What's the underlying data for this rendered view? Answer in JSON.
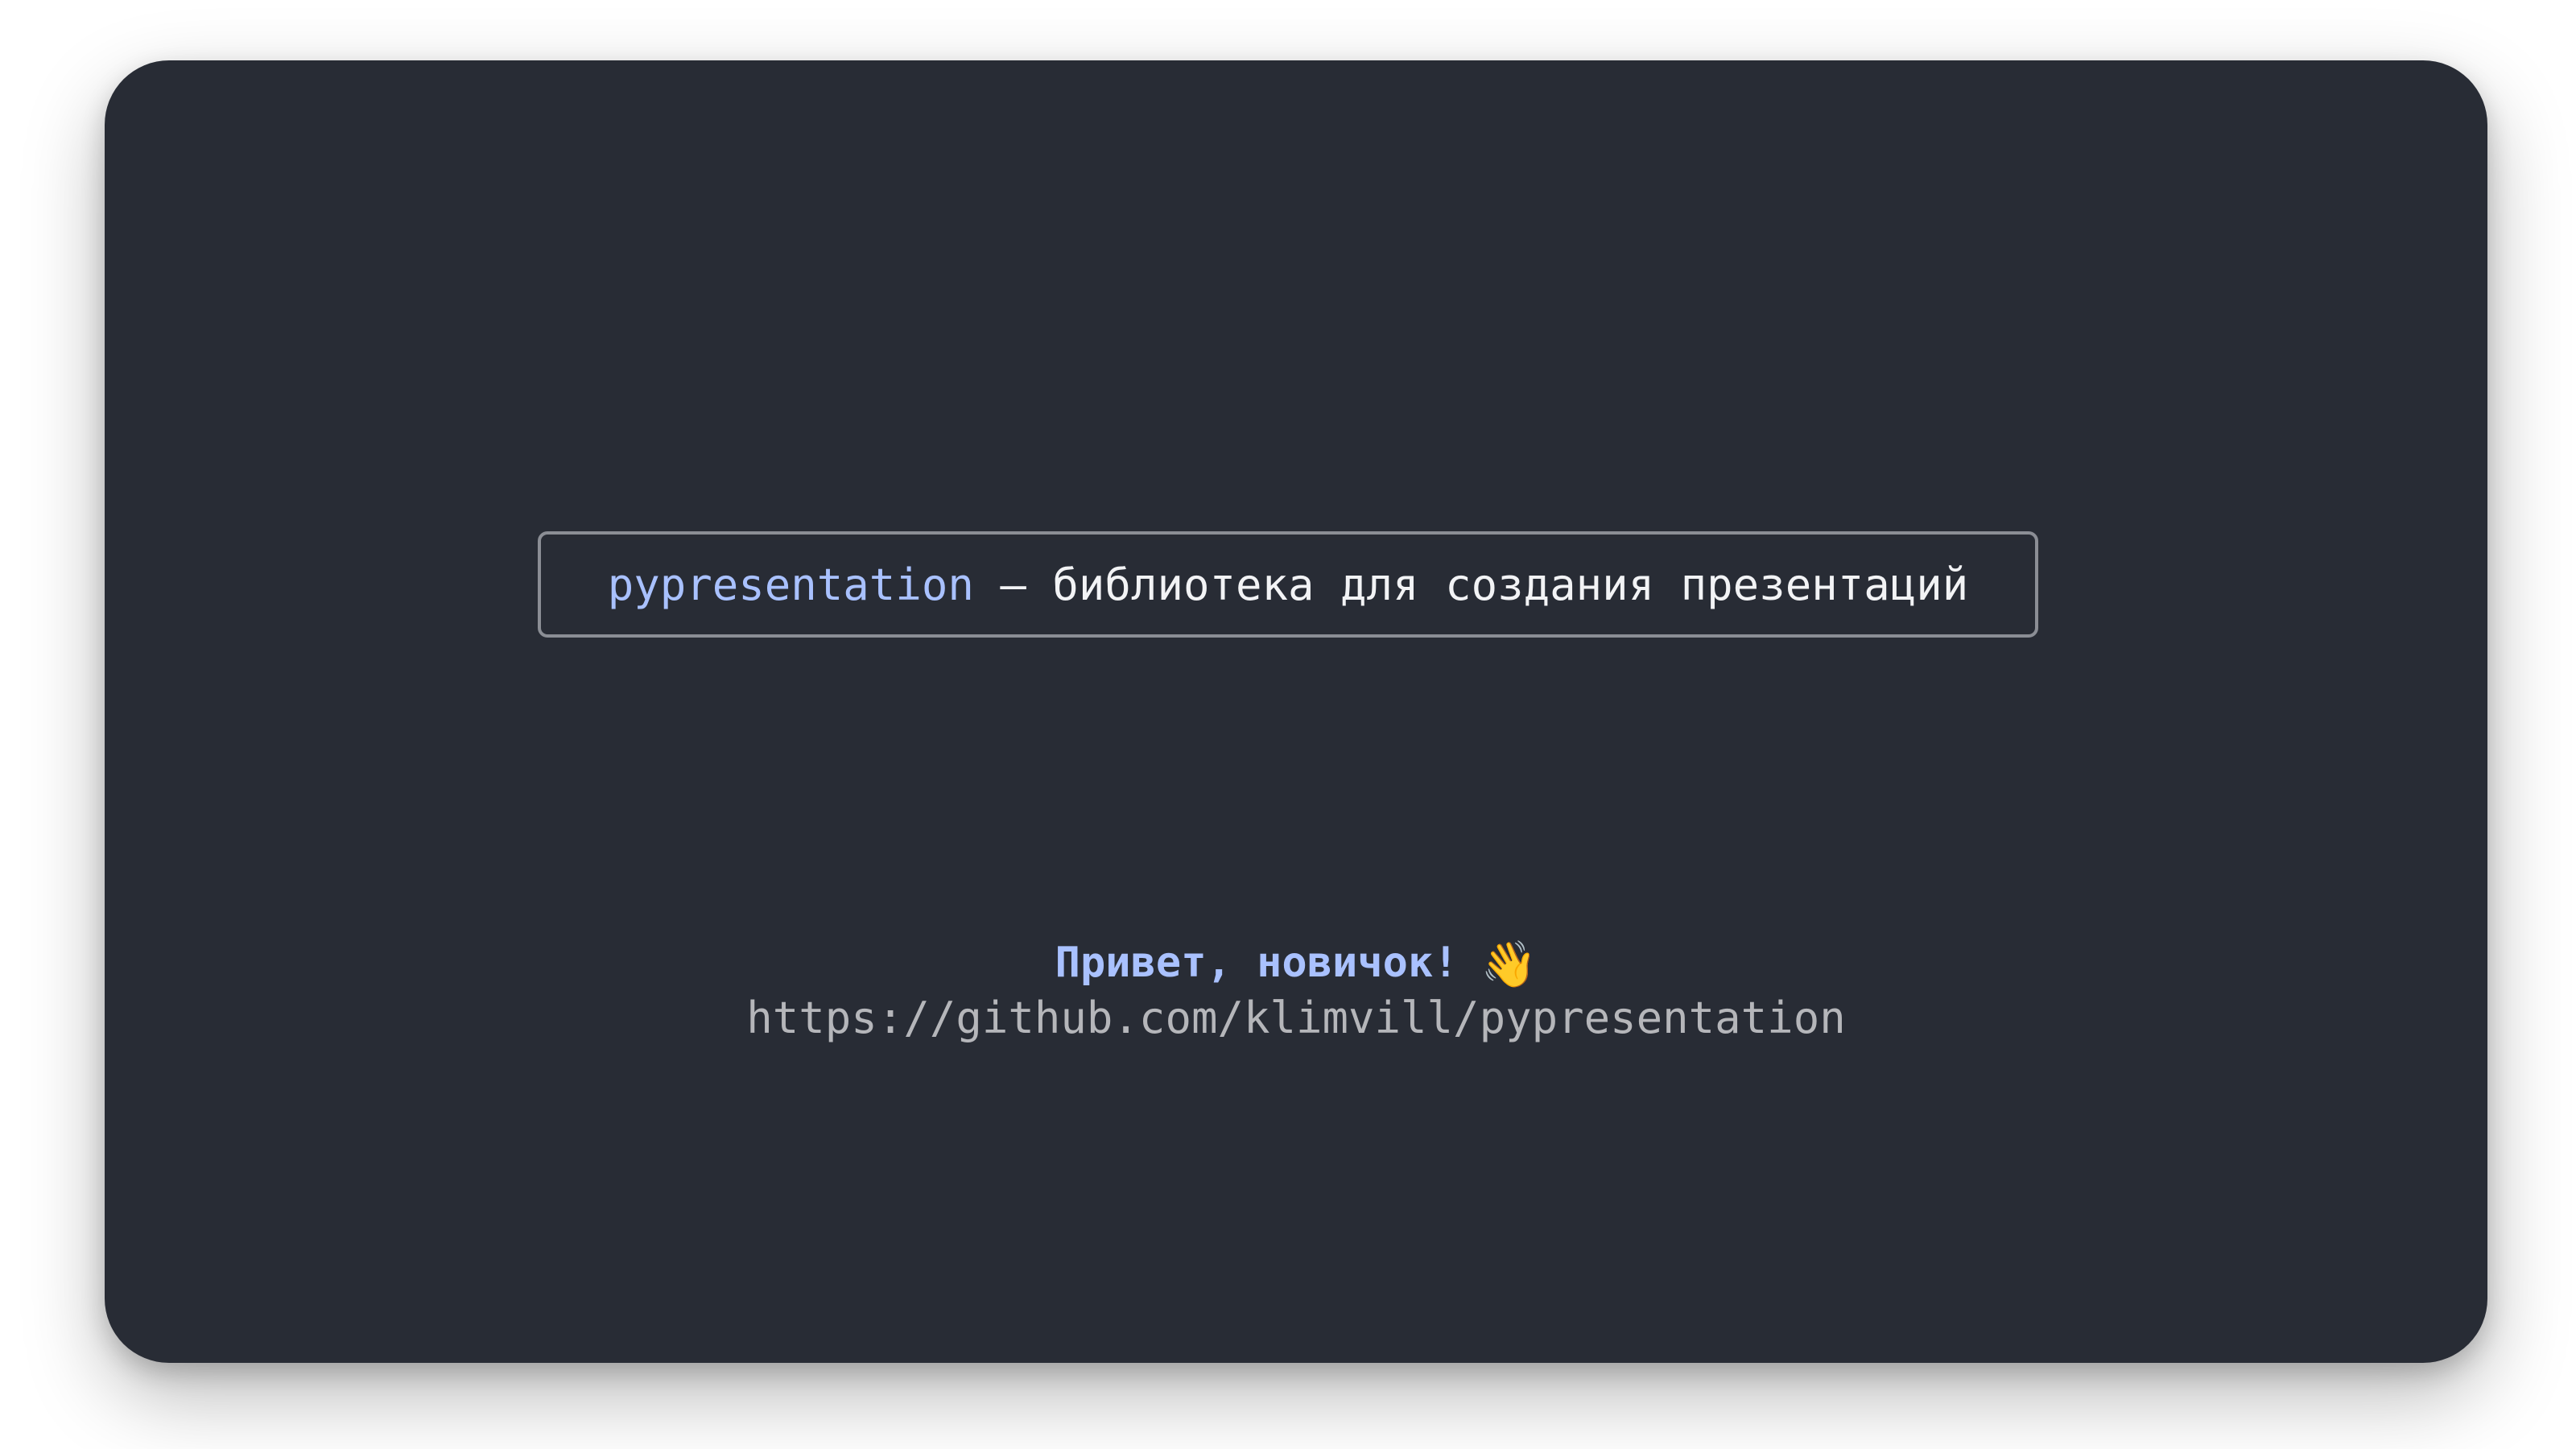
{
  "slide": {
    "library_name": "pypresentation",
    "dash": "–",
    "description": "библиотека для создания презентаций",
    "greeting": "Привет, новичок!",
    "greeting_emoji": "👋",
    "repo_url": "https://github.com/klimvill/pypresentation"
  },
  "colors": {
    "background": "#282c35",
    "accent": "#a9c1ff",
    "text": "#f2f3f5",
    "muted": "#b5b6ba",
    "border": "#8b8e95"
  }
}
